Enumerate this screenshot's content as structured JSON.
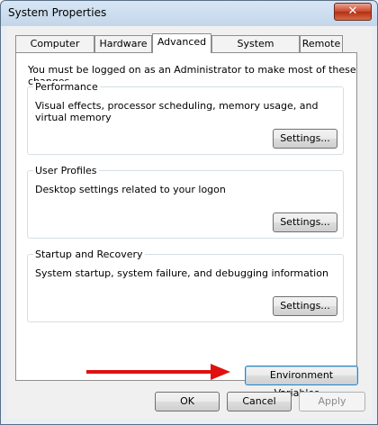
{
  "window": {
    "title": "System Properties",
    "close_label": "✕"
  },
  "tabs": [
    {
      "label": "Computer Name"
    },
    {
      "label": "Hardware"
    },
    {
      "label": "Advanced"
    },
    {
      "label": "System Protection"
    },
    {
      "label": "Remote"
    }
  ],
  "notice": "You must be logged on as an Administrator to make most of these changes.",
  "groups": {
    "performance": {
      "title": "Performance",
      "desc": "Visual effects, processor scheduling, memory usage, and virtual memory",
      "button": "Settings..."
    },
    "profiles": {
      "title": "User Profiles",
      "desc": "Desktop settings related to your logon",
      "button": "Settings..."
    },
    "startup": {
      "title": "Startup and Recovery",
      "desc": "System startup, system failure, and debugging information",
      "button": "Settings..."
    }
  },
  "env_button": "Environment Variables...",
  "footer": {
    "ok": "OK",
    "cancel": "Cancel",
    "apply": "Apply"
  },
  "colors": {
    "arrow": "#e01010",
    "accent": "#3c7fb1"
  }
}
